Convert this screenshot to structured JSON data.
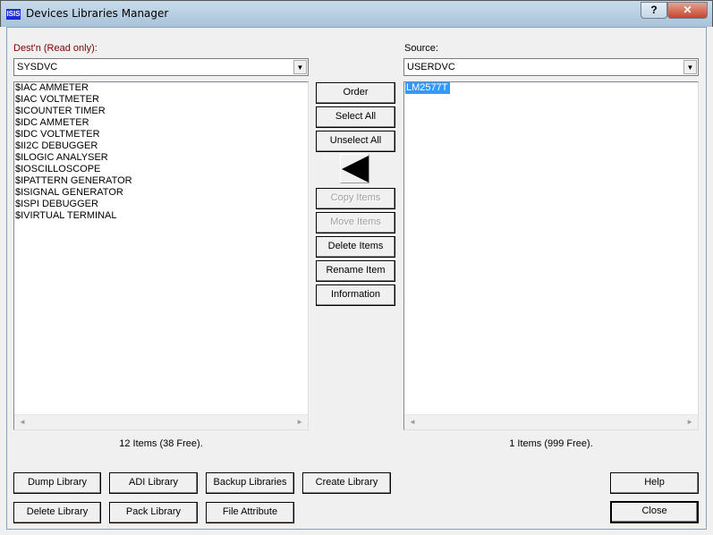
{
  "window": {
    "title": "Devices Libraries Manager",
    "icon_text": "ISIS",
    "help_btn": "?",
    "close_btn": "✕"
  },
  "dest": {
    "label": "Dest'n (Read only):",
    "value": "SYSDVC",
    "items": [
      "$IAC AMMETER",
      "$IAC VOLTMETER",
      "$ICOUNTER TIMER",
      "$IDC AMMETER",
      "$IDC VOLTMETER",
      "$II2C DEBUGGER",
      "$ILOGIC ANALYSER",
      "$IOSCILLOSCOPE",
      "$IPATTERN GENERATOR",
      "$ISIGNAL GENERATOR",
      "$ISPI DEBUGGER",
      "$IVIRTUAL TERMINAL"
    ],
    "count": "12 Items (38 Free)."
  },
  "source": {
    "label": "Source:",
    "value": "USERDVC",
    "items": [
      "LM2577T"
    ],
    "count": "1 Items (999 Free)."
  },
  "center_buttons": {
    "order": "Order",
    "select_all": "Select All",
    "unselect_all": "Unselect All",
    "copy": "Copy Items",
    "move": "Move Items",
    "delete": "Delete Items",
    "rename": "Rename Item",
    "information": "Information"
  },
  "bottom_buttons": {
    "dump": "Dump Library",
    "adi": "ADI Library",
    "backup": "Backup Libraries",
    "create": "Create Library",
    "delete_lib": "Delete Library",
    "pack": "Pack Library",
    "file_attr": "File Attribute",
    "help": "Help",
    "close": "Close"
  }
}
